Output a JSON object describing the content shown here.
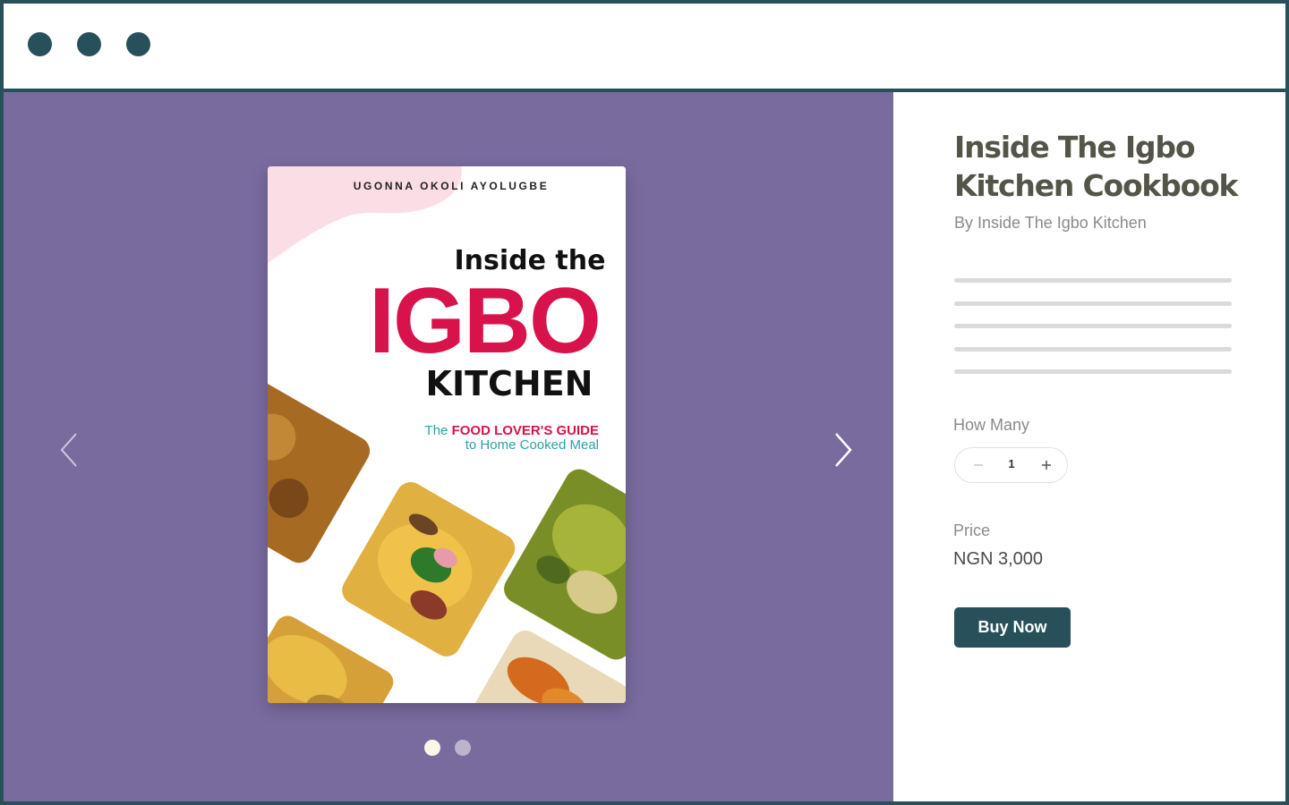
{
  "window": {
    "controls": [
      "window-dot",
      "window-dot",
      "window-dot"
    ]
  },
  "gallery": {
    "background": "#7a6b9f",
    "cover": {
      "author": "UGONNA OKOLI AYOLUGBE",
      "title_top": "Inside the",
      "title_main": "IGBO",
      "title_bottom": "KITCHEN",
      "tagline_prefix": "The",
      "tagline_highlight": "FOOD LOVER'S GUIDE",
      "tagline_line2": "to Home Cooked Meal",
      "colors": {
        "accent": "#d8134b",
        "teal": "#2aa0a8",
        "pink_blob": "#fbdde6"
      }
    },
    "prev_icon": "chevron-left-icon",
    "next_icon": "chevron-right-icon",
    "pagination": {
      "count": 2,
      "active": 1
    }
  },
  "product": {
    "title": "Inside The Igbo Kitchen Cookbook",
    "byline": "By Inside The Igbo Kitchen",
    "quantity_label": "How Many",
    "quantity_value": "1",
    "price_label": "Price",
    "price": "NGN 3,000",
    "buy_label": "Buy Now",
    "colors": {
      "button": "#27505a"
    }
  }
}
